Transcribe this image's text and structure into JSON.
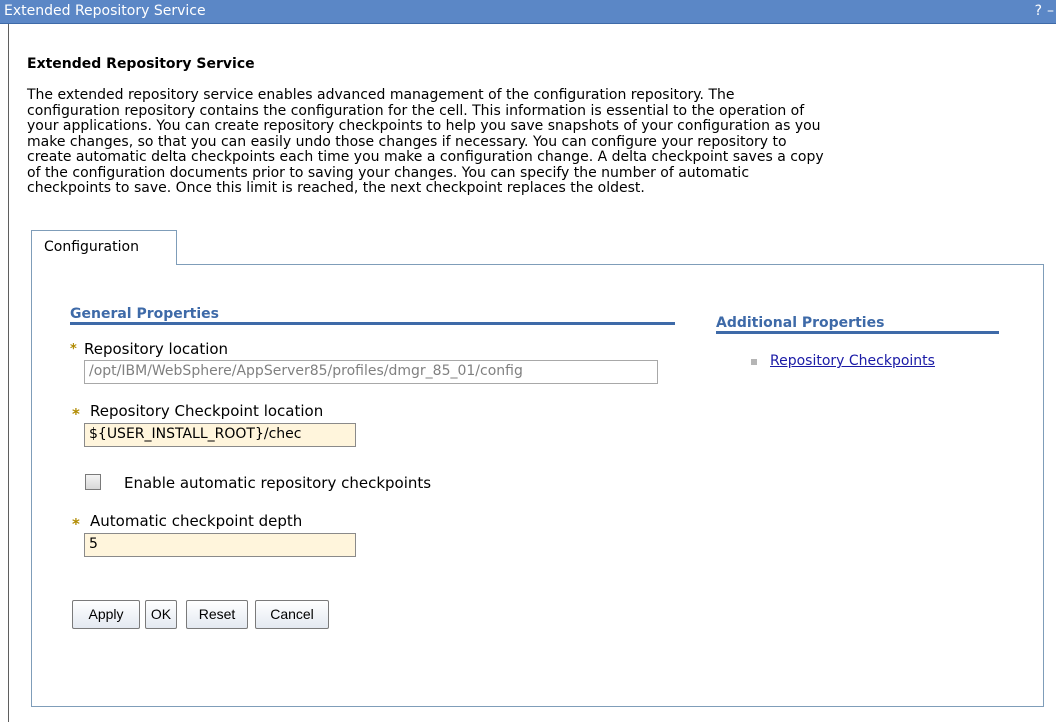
{
  "window": {
    "title": "Extended Repository Service",
    "help_glyph": "?",
    "minimize_glyph": "–"
  },
  "heading": "Extended Repository Service",
  "description_lines": [
    "The extended repository service enables advanced management of the configuration repository. The",
    "configuration repository contains the configuration for the cell. This information is essential to the operation of",
    "your applications. You can create repository checkpoints to help you save snapshots of your configuration as you",
    "make changes, so that you can easily undo those changes if necessary. You can configure your repository to",
    "create automatic delta checkpoints each time you make a configuration change. A delta checkpoint saves a copy",
    "of the configuration documents prior to saving your changes. You can specify the number of automatic",
    "checkpoints to save. Once this limit is reached, the next checkpoint replaces the oldest."
  ],
  "tabs": [
    {
      "label": "Configuration",
      "selected": true
    }
  ],
  "general": {
    "title": "General Properties",
    "required_marker": "*",
    "repo_location_label": "Repository location",
    "repo_location_value": "/opt/IBM/WebSphere/AppServer85/profiles/dmgr_85_01/config",
    "checkpoint_location_label": "Repository Checkpoint location",
    "checkpoint_location_value": "${USER_INSTALL_ROOT}/chec",
    "enable_label": "Enable automatic repository checkpoints",
    "enable_checked": false,
    "depth_label": "Automatic checkpoint depth",
    "depth_value": "5"
  },
  "additional": {
    "title": "Additional Properties",
    "links": [
      "Repository Checkpoints"
    ]
  },
  "buttons": {
    "apply": "Apply",
    "ok": "OK",
    "reset": "Reset",
    "cancel": "Cancel"
  },
  "colors": {
    "titlebar": "#5b87c6",
    "section_accent": "#3e6aa8",
    "required_field_bg": "#fff5dc",
    "link": "#1a1aa6"
  }
}
